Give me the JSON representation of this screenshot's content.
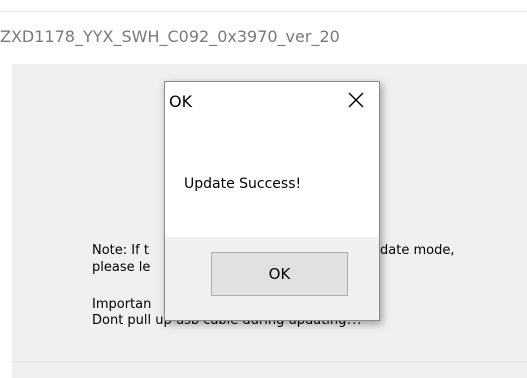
{
  "window": {
    "title": "ZXD1178_YYX_SWH_C092_0x3970_ver_20"
  },
  "main": {
    "note_line_1_left": "Note: If t",
    "note_line_1_right": "date mode,",
    "note_line_2": "please le",
    "important_line_1": "Importan",
    "important_line_2": "Dont pull up usb cable during updating!!!"
  },
  "dialog": {
    "title": "OK",
    "close_icon": "close-icon",
    "message": "Update Success!",
    "ok_label": "OK"
  }
}
